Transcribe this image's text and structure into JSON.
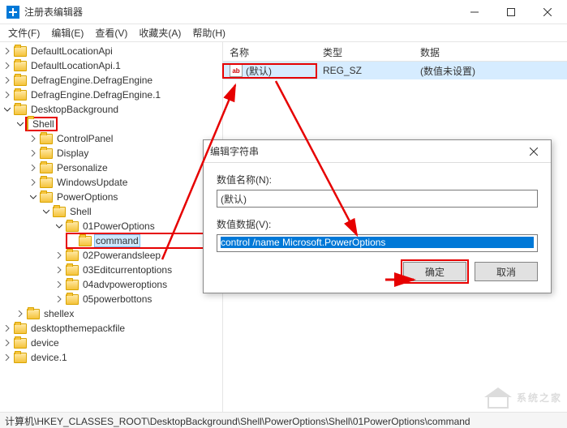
{
  "window": {
    "title": "注册表编辑器",
    "controls": {
      "min": "minimize",
      "max": "maximize",
      "close": "close"
    }
  },
  "menu": {
    "file": "文件(F)",
    "edit": "编辑(E)",
    "view": "查看(V)",
    "favorites": "收藏夹(A)",
    "help": "帮助(H)"
  },
  "tree": {
    "items": [
      "DefaultLocationApi",
      "DefaultLocationApi.1",
      "DefragEngine.DefragEngine",
      "DefragEngine.DefragEngine.1",
      "DesktopBackground"
    ],
    "shell": "Shell",
    "shell_children": [
      "ControlPanel",
      "Display",
      "Personalize",
      "WindowsUpdate"
    ],
    "power": "PowerOptions",
    "power_shell": "Shell",
    "power01": "01PowerOptions",
    "command": "command",
    "power_rest": [
      "02Powerandsleep",
      "03Editcurrentoptions",
      "04advpoweroptions",
      "05powerbottons"
    ],
    "after": [
      "shellex",
      "desktopthemepackfile",
      "device",
      "device.1"
    ]
  },
  "list": {
    "headers": {
      "name": "名称",
      "type": "类型",
      "data": "数据"
    },
    "row": {
      "name": "(默认)",
      "type": "REG_SZ",
      "data": "(数值未设置)",
      "icon": "ab"
    }
  },
  "dialog": {
    "title": "编辑字符串",
    "name_label": "数值名称(N):",
    "name_value": "(默认)",
    "data_label": "数值数据(V):",
    "data_value": "control /name Microsoft.PowerOptions",
    "ok": "确定",
    "cancel": "取消"
  },
  "statusbar": {
    "path": "计算机\\HKEY_CLASSES_ROOT\\DesktopBackground\\Shell\\PowerOptions\\Shell\\01PowerOptions\\command"
  },
  "watermark": {
    "text": "系统之家"
  }
}
